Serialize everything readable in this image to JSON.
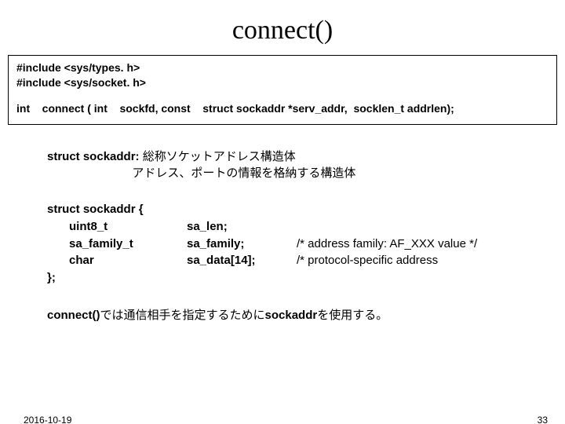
{
  "title": "connect()",
  "codebox": {
    "include1": "#include <sys/types. h>",
    "include2": "#include <sys/socket. h>",
    "sig": "int    connect ( int    sockfd, const    struct sockaddr *serv_addr,  socklen_t addrlen);"
  },
  "sockaddr_label": "struct sockaddr: ",
  "sockaddr_desc1": "総称ソケットアドレス構造体",
  "sockaddr_desc2": "                          アドレス、ポートの情報を格納する構造体",
  "struct": {
    "open": "struct sockaddr {",
    "m1_type": "uint8_t",
    "m1_name": "sa_len;",
    "m1_comment": "",
    "m2_type": "sa_family_t",
    "m2_name": "sa_family;",
    "m2_comment": "/* address family: AF_XXX value */",
    "m3_type": "char",
    "m3_name": "sa_data[14];",
    "m3_comment": "/* protocol-specific address",
    "close": "};"
  },
  "desc_bold": "connect()",
  "desc_mid": "では通信相手を指定するために",
  "desc_bold2": "sockaddr",
  "desc_end": "を使用する。",
  "footer": {
    "date": "2016-10-19",
    "page": "33"
  }
}
